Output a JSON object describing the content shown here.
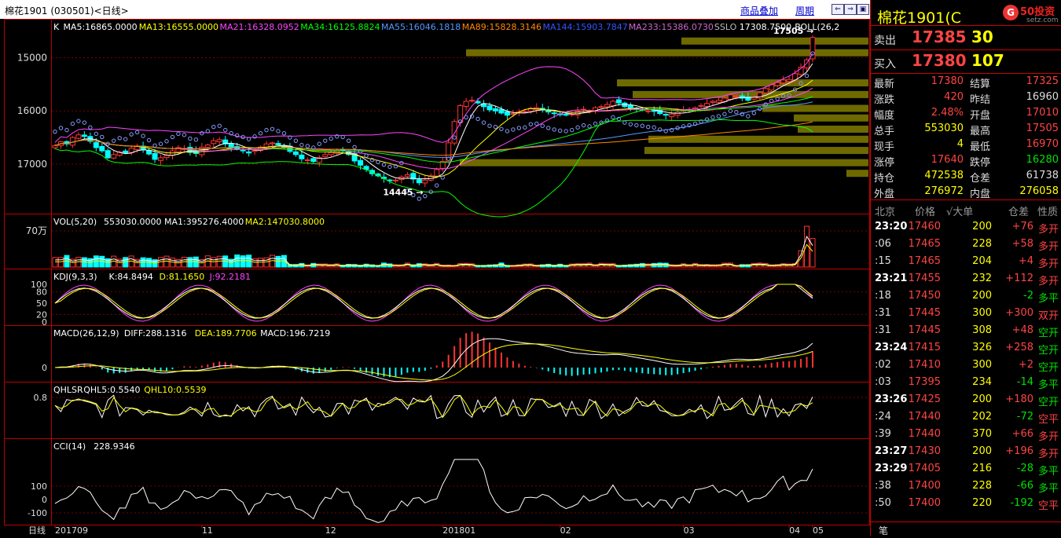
{
  "window": {
    "title": "棉花1901 (030501)<日线>",
    "btn_overlay": "商品叠加",
    "btn_period": "周期"
  },
  "panes": {
    "k_legend": [
      {
        "text": "K",
        "color": "#ffffff"
      },
      {
        "text": "MA5:16865.0000",
        "color": "#ffffff"
      },
      {
        "text": "MA13:16555.0000",
        "color": "#ffff00"
      },
      {
        "text": "MA21:16328.0952",
        "color": "#ff44ff"
      },
      {
        "text": "MA34:16125.8824",
        "color": "#00ff00"
      },
      {
        "text": "MA55:16046.1818",
        "color": "#5599ff"
      },
      {
        "text": "MA89:15828.3146",
        "color": "#ff8800"
      },
      {
        "text": "MA144:15903.7847",
        "color": "#3355ff"
      },
      {
        "text": "MA233:15386.0730",
        "color": "#cc66cc"
      },
      {
        "text": "SSLO",
        "color": "#bbbbbb"
      },
      {
        "text": "17308.7500",
        "color": "#ffffff"
      },
      {
        "text": "BOLL(26,2",
        "color": "#ffffff"
      }
    ],
    "price_ticks": [
      "17000",
      "16000",
      "15000"
    ],
    "high_label": "17505",
    "low_label": "14445",
    "vol_legend": [
      {
        "text": "VOL(5,20)",
        "color": "#ffffff"
      },
      {
        "text": "553030.0000",
        "color": "#ffffff"
      },
      {
        "text": "MA1:395276.4000",
        "color": "#ffffff"
      },
      {
        "text": "MA2:147030.8000",
        "color": "#ffff00"
      }
    ],
    "vol_tick": "70万",
    "kdj_legend": [
      {
        "text": "KDJ(9,3,3)",
        "color": "#ffffff"
      },
      {
        "text": "K:84.8494",
        "color": "#ffffff"
      },
      {
        "text": "D:81.1650",
        "color": "#ffff00"
      },
      {
        "text": "J:92.2181",
        "color": "#ff44ff"
      }
    ],
    "kdj_ticks": [
      "100",
      "80",
      "50",
      "20",
      "0"
    ],
    "macd_legend": [
      {
        "text": "MACD(26,12,9)",
        "color": "#ffffff"
      },
      {
        "text": "DIFF:288.1316",
        "color": "#ffffff"
      },
      {
        "text": "DEA:189.7706",
        "color": "#ffff00"
      },
      {
        "text": "MACD:196.7219",
        "color": "#ffffff"
      }
    ],
    "macd_tick": "0",
    "qhlsr_legend": [
      {
        "text": "QHLSR",
        "color": "#ffffff"
      },
      {
        "text": "QHL5:0.5540",
        "color": "#ffffff"
      },
      {
        "text": "QHL10:0.5539",
        "color": "#ffff00"
      }
    ],
    "qhlsr_tick": "0.8",
    "cci_legend": [
      {
        "text": "CCI(14)",
        "color": "#ffffff"
      },
      {
        "text": "228.9346",
        "color": "#ffffff"
      }
    ],
    "cci_ticks": [
      "100",
      "0",
      "-100"
    ],
    "axis_period": "日线",
    "x_labels": [
      "201709",
      "11",
      "12",
      "201801",
      "02",
      "03",
      "04",
      "05"
    ]
  },
  "panel": {
    "title": "棉花1901(C",
    "logo_name": "50投资",
    "logo_domain": "setz.com",
    "sell_label": "卖出",
    "sell_price": "17385",
    "sell_vol": "30",
    "buy_label": "买入",
    "buy_price": "17380",
    "buy_vol": "107",
    "stats": [
      {
        "l1": "最新",
        "v1": "17380",
        "l2": "结算",
        "v2": "17325"
      },
      {
        "l1": "涨跌",
        "v1": "420",
        "l2": "昨结",
        "v2": "16960"
      },
      {
        "l1": "幅度",
        "v1": "2.48%",
        "l2": "开盘",
        "v2": "17010"
      },
      {
        "l1": "总手",
        "v1": "553030",
        "l2": "最高",
        "v2": "17505"
      },
      {
        "l1": "现手",
        "v1": "4",
        "l2": "最低",
        "v2": "16970"
      },
      {
        "l1": "涨停",
        "v1": "17640",
        "l2": "跌停",
        "v2": "16280"
      },
      {
        "l1": "持仓",
        "v1": "472538",
        "l2": "仓差",
        "v2": "61738"
      },
      {
        "l1": "外盘",
        "v1": "276972",
        "l2": "内盘",
        "v2": "276058"
      }
    ],
    "tick_header": {
      "time": "北京",
      "price": "价格",
      "vol": "√大单",
      "diff": "仓差",
      "nature": "性质"
    },
    "ticks": [
      {
        "time": "23:20",
        "price": "17460",
        "vol": "200",
        "diff": "+76",
        "nature": "多开",
        "bold": true,
        "nc": "red"
      },
      {
        "time": ":06",
        "price": "17465",
        "vol": "228",
        "diff": "+58",
        "nature": "多开",
        "bold": false,
        "nc": "red"
      },
      {
        "time": ":15",
        "price": "17465",
        "vol": "204",
        "diff": "+4",
        "nature": "多开",
        "bold": false,
        "nc": "red"
      },
      {
        "time": "23:21",
        "price": "17455",
        "vol": "232",
        "diff": "+112",
        "nature": "多开",
        "bold": true,
        "nc": "red"
      },
      {
        "time": ":18",
        "price": "17450",
        "vol": "200",
        "diff": "-2",
        "nature": "多平",
        "bold": false,
        "nc": "green"
      },
      {
        "time": ":31",
        "price": "17445",
        "vol": "300",
        "diff": "+300",
        "nature": "双开",
        "bold": false,
        "nc": "red"
      },
      {
        "time": ":31",
        "price": "17445",
        "vol": "308",
        "diff": "+48",
        "nature": "空开",
        "bold": false,
        "nc": "green"
      },
      {
        "time": "23:24",
        "price": "17415",
        "vol": "326",
        "diff": "+258",
        "nature": "空开",
        "bold": true,
        "nc": "green"
      },
      {
        "time": ":02",
        "price": "17410",
        "vol": "300",
        "diff": "+2",
        "nature": "空开",
        "bold": false,
        "nc": "green"
      },
      {
        "time": ":03",
        "price": "17395",
        "vol": "234",
        "diff": "-14",
        "nature": "多平",
        "bold": false,
        "nc": "green"
      },
      {
        "time": "23:26",
        "price": "17425",
        "vol": "200",
        "diff": "+180",
        "nature": "空开",
        "bold": true,
        "nc": "green"
      },
      {
        "time": ":24",
        "price": "17440",
        "vol": "202",
        "diff": "-72",
        "nature": "空平",
        "bold": false,
        "nc": "red"
      },
      {
        "time": ":39",
        "price": "17440",
        "vol": "370",
        "diff": "+66",
        "nature": "多开",
        "bold": false,
        "nc": "red"
      },
      {
        "time": "23:27",
        "price": "17430",
        "vol": "200",
        "diff": "+196",
        "nature": "多开",
        "bold": true,
        "nc": "red"
      },
      {
        "time": "23:29",
        "price": "17405",
        "vol": "216",
        "diff": "-28",
        "nature": "多平",
        "bold": true,
        "nc": "green"
      },
      {
        "time": ":38",
        "price": "17400",
        "vol": "228",
        "diff": "-66",
        "nature": "多平",
        "bold": false,
        "nc": "green"
      },
      {
        "time": ":50",
        "price": "17400",
        "vol": "220",
        "diff": "-192",
        "nature": "空平",
        "bold": false,
        "nc": "red"
      }
    ],
    "footer": "笔"
  },
  "chart_data": {
    "type": "candlestick",
    "title": "棉花1901 (030501)<日线>",
    "xlabel": "",
    "ylabel": "",
    "x": [
      "201709",
      "11",
      "12",
      "201801",
      "02",
      "03",
      "04",
      "05"
    ],
    "ylim": [
      14100,
      17700
    ],
    "ticks_y": [
      15000,
      16000,
      17000
    ],
    "ohlc_closes": [
      15350,
      15420,
      15380,
      15500,
      15550,
      15520,
      15430,
      15310,
      15250,
      15120,
      15180,
      15230,
      15210,
      15300,
      15340,
      15270,
      15190,
      15090,
      15120,
      15170,
      15250,
      15310,
      15290,
      15220,
      15200,
      15320,
      15360,
      15440,
      15460,
      15380,
      15320,
      15280,
      15250,
      15210,
      15260,
      15320,
      15380,
      15400,
      15360,
      15320,
      15240,
      15180,
      15100,
      15080,
      15050,
      15120,
      15180,
      15220,
      15260,
      15250,
      15180,
      15060,
      14980,
      14900,
      14820,
      14780,
      14730,
      14690,
      14700,
      14760,
      14800,
      14720,
      14650,
      14700,
      14780,
      14900,
      15050,
      15400,
      15800,
      16100,
      16180,
      16200,
      16150,
      16080,
      16020,
      16000,
      15960,
      15920,
      15950,
      15980,
      15990,
      16050,
      16060,
      16020,
      15980,
      15950,
      15930,
      15920,
      15940,
      15990,
      16030,
      16010,
      16060,
      16080,
      16120,
      16180,
      16150,
      16080,
      16050,
      16030,
      16020,
      16000,
      15990,
      15950,
      15920,
      15940,
      15980,
      16010,
      16030,
      16060,
      16100,
      16140,
      16180,
      16200,
      16240,
      16300,
      16280,
      16240,
      16200,
      16260,
      16340,
      16420,
      16490,
      16530,
      16580,
      16590,
      16700,
      16820,
      16960,
      17380
    ],
    "high": 17505,
    "low": 14445,
    "last_close": 17380,
    "volume_max_label": "70万",
    "series": [
      {
        "name": "MA5",
        "value": 16865.0
      },
      {
        "name": "MA13",
        "value": 16555.0
      },
      {
        "name": "MA21",
        "value": 16328.0952
      },
      {
        "name": "MA34",
        "value": 16125.8824
      },
      {
        "name": "MA55",
        "value": 16046.1818
      },
      {
        "name": "MA89",
        "value": 15828.3146
      },
      {
        "name": "MA144",
        "value": 15903.7847
      },
      {
        "name": "MA233",
        "value": 15386.073
      }
    ],
    "indicators": {
      "VOL": {
        "value": 553030.0,
        "MA1": 395276.4,
        "MA2": 147030.8
      },
      "KDJ": {
        "K": 84.8494,
        "D": 81.165,
        "J": 92.2181
      },
      "MACD": {
        "DIFF": 288.1316,
        "DEA": 189.7706,
        "MACD": 196.7219
      },
      "QHLSR": {
        "QHL5": 0.554,
        "QHL10": 0.5539
      },
      "CCI": {
        "value": 228.9346
      }
    },
    "volume_profile_levels": [
      17305,
      17085,
      16520,
      16300,
      16040,
      15860,
      15650,
      15460,
      15250,
      15020,
      14820
    ]
  }
}
